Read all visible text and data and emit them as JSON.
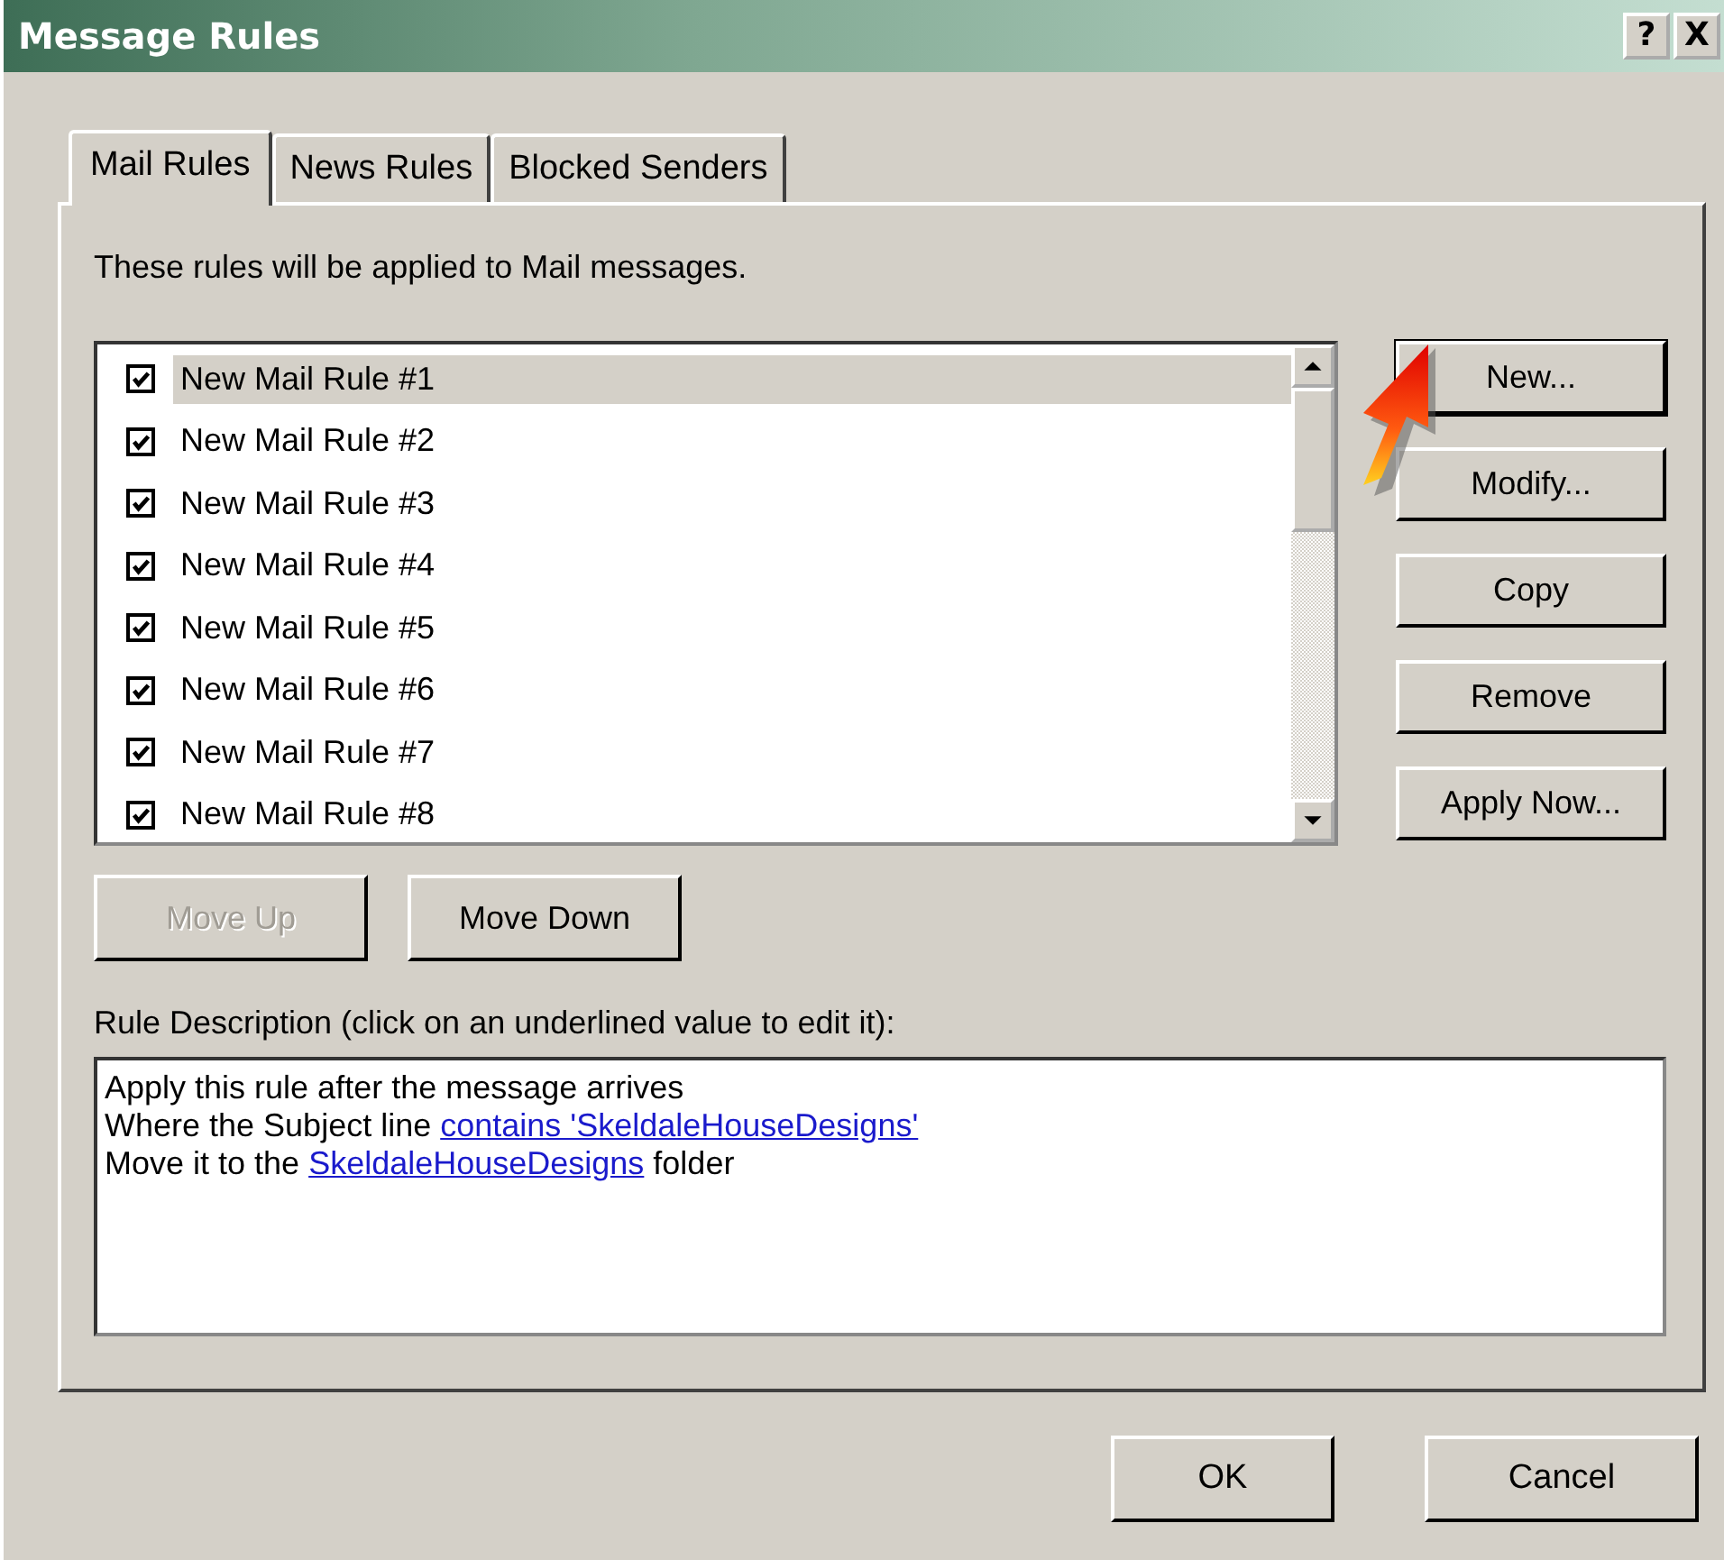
{
  "window": {
    "title": "Message Rules",
    "help_button": "?",
    "close_button": "X"
  },
  "tabs": [
    {
      "label": "Mail Rules",
      "selected": true
    },
    {
      "label": "News Rules",
      "selected": false
    },
    {
      "label": "Blocked Senders",
      "selected": false
    }
  ],
  "intro": "These rules will be applied to Mail messages.",
  "rules": [
    {
      "name": "New Mail Rule #1",
      "checked": true,
      "selected": true
    },
    {
      "name": "New Mail Rule #2",
      "checked": true,
      "selected": false
    },
    {
      "name": "New Mail Rule #3",
      "checked": true,
      "selected": false
    },
    {
      "name": "New Mail Rule #4",
      "checked": true,
      "selected": false
    },
    {
      "name": "New Mail Rule #5",
      "checked": true,
      "selected": false
    },
    {
      "name": "New Mail Rule #6",
      "checked": true,
      "selected": false
    },
    {
      "name": "New Mail Rule #7",
      "checked": true,
      "selected": false
    },
    {
      "name": "New Mail Rule #8",
      "checked": true,
      "selected": false
    }
  ],
  "side_buttons": [
    {
      "label": "New...",
      "default": true
    },
    {
      "label": "Modify...",
      "default": false
    },
    {
      "label": "Copy",
      "default": false
    },
    {
      "label": "Remove",
      "default": false
    },
    {
      "label": "Apply Now...",
      "default": false
    }
  ],
  "move_buttons": [
    {
      "label": "Move Up",
      "disabled": true
    },
    {
      "label": "Move Down",
      "disabled": false
    }
  ],
  "description_label": "Rule Description (click on an underlined value to edit it):",
  "description_lines": [
    [
      {
        "text": "Apply this rule after the message arrives",
        "link": false
      }
    ],
    [
      {
        "text": "Where the Subject line ",
        "link": false
      },
      {
        "text": "contains 'SkeldaleHouseDesigns'",
        "link": true
      }
    ],
    [
      {
        "text": "Move it to the ",
        "link": false
      },
      {
        "text": "SkeldaleHouseDesigns",
        "link": true
      },
      {
        "text": " folder",
        "link": false
      }
    ]
  ],
  "dialog_buttons": [
    {
      "label": "OK"
    },
    {
      "label": "Cancel"
    }
  ]
}
